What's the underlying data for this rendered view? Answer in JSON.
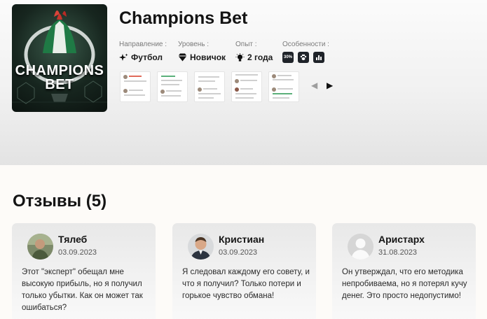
{
  "app": {
    "title": "Champions Bet",
    "logo_text_line1": "CHAMPIONS",
    "logo_text_line2": "BET"
  },
  "meta": {
    "direction_label": "Направление :",
    "direction_value": "Футбол",
    "level_label": "Уровень :",
    "level_value": "Новичок",
    "experience_label": "Опыт :",
    "experience_value": "2 года",
    "features_label": "Особенности :",
    "features": [
      {
        "icon": "percent-badge-icon",
        "text": "30%"
      },
      {
        "icon": "paw-icon",
        "text": ""
      },
      {
        "icon": "bar-chart-icon",
        "text": ""
      }
    ]
  },
  "gallery": {
    "thumbnail_count": 5,
    "prev_icon": "chevron-left-icon",
    "next_icon": "chevron-right-icon"
  },
  "reviews": {
    "heading": "Отзывы (5)",
    "items": [
      {
        "name": "Тялеб",
        "date": "03.09.2023",
        "text": "Этот \"эксперт\" обещал мне высокую прибыль, но я получил только убытки. Как он может так ошибаться?"
      },
      {
        "name": "Кристиан",
        "date": "03.09.2023",
        "text": "Я следовал каждому его совету, и что я получил? Только потери и горькое чувство обмана!"
      },
      {
        "name": "Аристарх",
        "date": "31.08.2023",
        "text": "Он утверждал, что его методика непробиваема, но я потерял кучу денег. Это просто недопустимо!"
      }
    ]
  },
  "colors": {
    "feature_badge_bg": "#1f2329",
    "card_bg": "#efefef",
    "page_bg": "#fdfbf8"
  }
}
